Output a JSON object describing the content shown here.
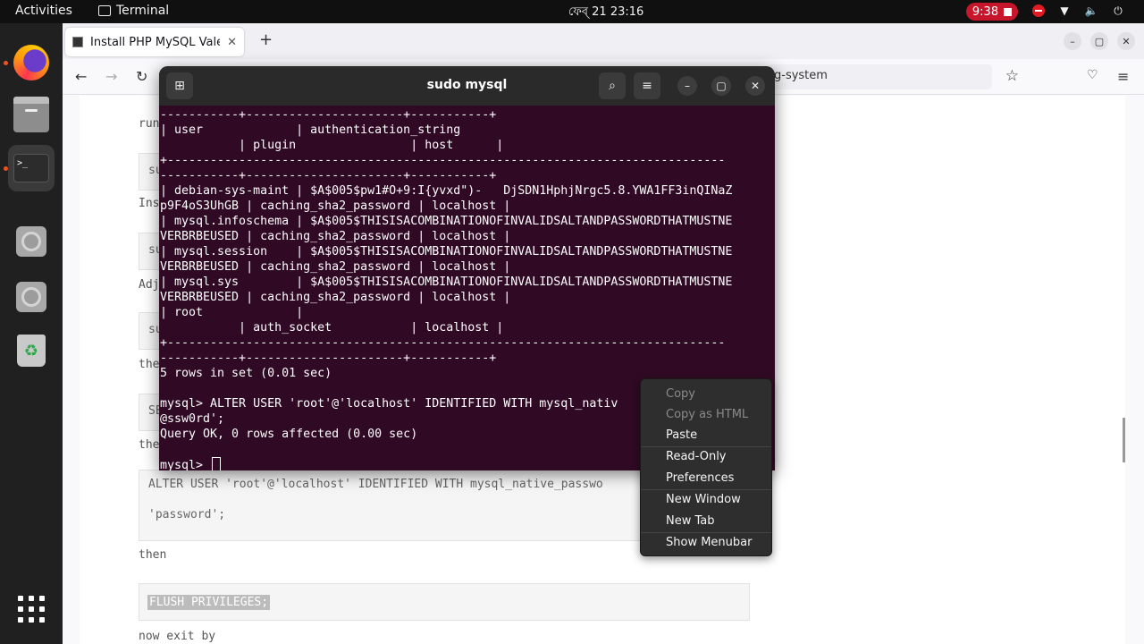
{
  "topbar": {
    "activities": "Activities",
    "app_name": "Terminal",
    "clock": "ফেব্ 21  23:16",
    "recording_time": "9:38"
  },
  "browser": {
    "tab_title": "Install PHP MySQL Valet",
    "tab_close": "✕",
    "new_tab": "+",
    "url_fragment": "g-system",
    "win_minimize": "–",
    "win_maximize": "▢",
    "win_close": "✕"
  },
  "page": {
    "left_fragments": [
      "run",
      "su",
      "Ins",
      "su",
      "Adj",
      "su",
      "the",
      "SE",
      "the"
    ],
    "code_alter_fragment": "ALTER USER 'root'@'localhost' IDENTIFIED WITH mysql_native_passwo",
    "code_password": "'password';",
    "then": "then",
    "flush": "FLUSH PRIVILEGES;",
    "now_exit": "now exit by"
  },
  "terminal": {
    "title": "sudo mysql",
    "lines": [
      "-----------+----------------------+-----------+",
      "| user             | authentication_string",
      "           | plugin                | host      |",
      "+------------------------------------------------------------------------------",
      "-----------+----------------------+-----------+",
      "| debian-sys-maint | $A$005$pw1#O+9:I{yvxd\")-   DjSDN1HphjNrgc5.8.YWA1FF3inQINaZ",
      "p9F4oS3UhGB | caching_sha2_password | localhost |",
      "| mysql.infoschema | $A$005$THISISACOMBINATIONOFINVALIDSALTANDPASSWORDTHATMUSTNE",
      "VERBRBEUSED | caching_sha2_password | localhost |",
      "| mysql.session    | $A$005$THISISACOMBINATIONOFINVALIDSALTANDPASSWORDTHATMUSTNE",
      "VERBRBEUSED | caching_sha2_password | localhost |",
      "| mysql.sys        | $A$005$THISISACOMBINATIONOFINVALIDSALTANDPASSWORDTHATMUSTNE",
      "VERBRBEUSED | caching_sha2_password | localhost |",
      "| root             |",
      "           | auth_socket           | localhost |",
      "+------------------------------------------------------------------------------",
      "-----------+----------------------+-----------+",
      "5 rows in set (0.01 sec)",
      "",
      "mysql> ALTER USER 'root'@'localhost' IDENTIFIED WITH mysql_nativ",
      "@ssw0rd';",
      "Query OK, 0 rows affected (0.00 sec)",
      ""
    ],
    "prompt": "mysql> "
  },
  "context_menu": {
    "items": [
      "Copy",
      "Copy as HTML",
      "Paste",
      "Read-Only",
      "Preferences",
      "New Window",
      "New Tab",
      "Show Menubar"
    ]
  },
  "colors": {
    "terminal_bg": "#300a24",
    "accent": "#e95420",
    "record": "#c7162b"
  }
}
